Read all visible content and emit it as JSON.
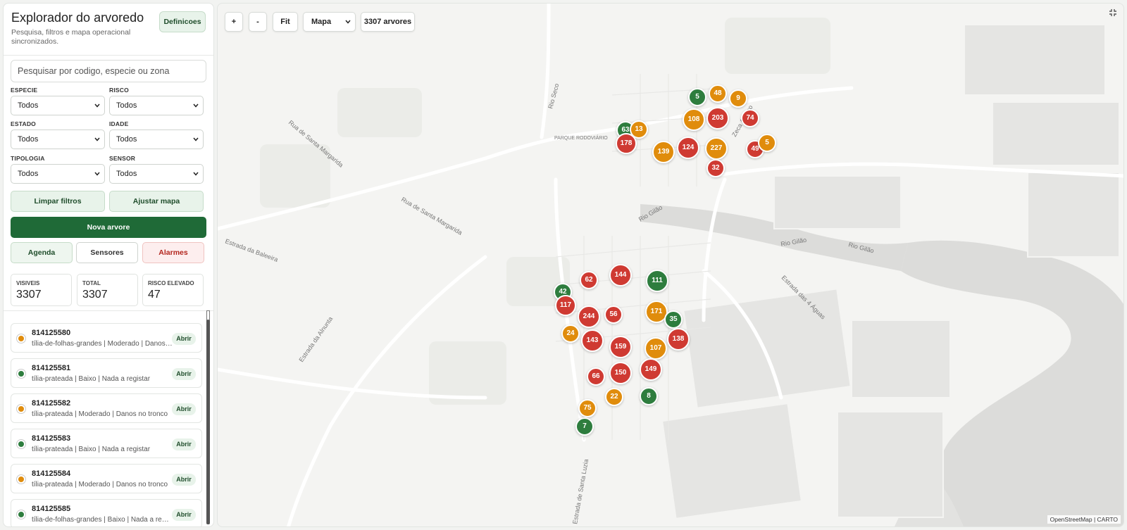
{
  "sidebar": {
    "title": "Explorador do arvoredo",
    "subtitle": "Pesquisa, filtros e mapa operacional sincronizados.",
    "settings_label": "Definicoes",
    "search_placeholder": "Pesquisar por codigo, especie ou zona",
    "filters": [
      {
        "label": "ESPECIE",
        "value": "Todos"
      },
      {
        "label": "RISCO",
        "value": "Todos"
      },
      {
        "label": "ESTADO",
        "value": "Todos"
      },
      {
        "label": "IDADE",
        "value": "Todos"
      },
      {
        "label": "TIPOLOGIA",
        "value": "Todos"
      },
      {
        "label": "SENSOR",
        "value": "Todos"
      }
    ],
    "clear_filters_label": "Limpar filtros",
    "fit_map_label": "Ajustar mapa",
    "new_tree_label": "Nova arvore",
    "agenda_label": "Agenda",
    "sensors_label": "Sensores",
    "alarms_label": "Alarmes",
    "stats": [
      {
        "label": "VISIVEIS",
        "value": "3307"
      },
      {
        "label": "TOTAL",
        "value": "3307"
      },
      {
        "label": "RISCO ELEVADO",
        "value": "47"
      }
    ],
    "items": [
      {
        "code": "814125580",
        "desc": "tília-de-folhas-grandes | Moderado | Danos no tronco",
        "status": "moderate",
        "open": "Abrir"
      },
      {
        "code": "814125581",
        "desc": "tília-prateada | Baixo | Nada a registar",
        "status": "low",
        "open": "Abrir"
      },
      {
        "code": "814125582",
        "desc": "tília-prateada | Moderado | Danos no tronco",
        "status": "moderate",
        "open": "Abrir"
      },
      {
        "code": "814125583",
        "desc": "tília-prateada | Baixo | Nada a registar",
        "status": "low",
        "open": "Abrir"
      },
      {
        "code": "814125584",
        "desc": "tília-prateada | Moderado | Danos no tronco",
        "status": "moderate",
        "open": "Abrir"
      },
      {
        "code": "814125585",
        "desc": "tília-de-folhas-grandes | Baixo | Nada a registar",
        "status": "low",
        "open": "Abrir"
      }
    ]
  },
  "map": {
    "zoom_in": "+",
    "zoom_out": "-",
    "fit": "Fit",
    "layer": "Mapa",
    "count": "3307 arvores",
    "attribution": "OpenStreetMap | CARTO",
    "labels": {
      "parque": "PARQUE RODOVIÁRIO",
      "rua_sta_margarida_1": "Rua de Santa Margarida",
      "rua_sta_margarida_2": "Rua de Santa Margarida",
      "estrada_baleeira": "Estrada da Baleeira",
      "estrada_alnunta": "Estrada da Alnunta",
      "estrada_sta_luzia": "Estrada de Santa Luzia",
      "rio_gilao_1": "Rio Gilão",
      "rio_gilao_2": "Rio Gilão",
      "rio_gilao_3": "Rio Gilão",
      "rio_seco": "Rio Seco",
      "estrada_quatro_aguas": "Estrada das 4 Águas",
      "zeca_afonso": "Zeca Afonso"
    },
    "clusters": [
      {
        "n": "5",
        "risk": "low"
      },
      {
        "n": "48",
        "risk": "moderate"
      },
      {
        "n": "9",
        "risk": "moderate"
      },
      {
        "n": "108",
        "risk": "moderate"
      },
      {
        "n": "203",
        "risk": "high"
      },
      {
        "n": "74",
        "risk": "high"
      },
      {
        "n": "63",
        "risk": "low"
      },
      {
        "n": "13",
        "risk": "moderate"
      },
      {
        "n": "178",
        "risk": "high"
      },
      {
        "n": "139",
        "risk": "moderate"
      },
      {
        "n": "124",
        "risk": "high"
      },
      {
        "n": "227",
        "risk": "moderate"
      },
      {
        "n": "49",
        "risk": "high"
      },
      {
        "n": "5",
        "risk": "moderate"
      },
      {
        "n": "32",
        "risk": "high"
      },
      {
        "n": "62",
        "risk": "high"
      },
      {
        "n": "144",
        "risk": "high"
      },
      {
        "n": "111",
        "risk": "low"
      },
      {
        "n": "42",
        "risk": "low"
      },
      {
        "n": "117",
        "risk": "high"
      },
      {
        "n": "244",
        "risk": "high"
      },
      {
        "n": "56",
        "risk": "high"
      },
      {
        "n": "171",
        "risk": "moderate"
      },
      {
        "n": "35",
        "risk": "low"
      },
      {
        "n": "24",
        "risk": "moderate"
      },
      {
        "n": "143",
        "risk": "high"
      },
      {
        "n": "159",
        "risk": "high"
      },
      {
        "n": "107",
        "risk": "moderate"
      },
      {
        "n": "138",
        "risk": "high"
      },
      {
        "n": "66",
        "risk": "high"
      },
      {
        "n": "150",
        "risk": "high"
      },
      {
        "n": "149",
        "risk": "high"
      },
      {
        "n": "22",
        "risk": "moderate"
      },
      {
        "n": "8",
        "risk": "low"
      },
      {
        "n": "75",
        "risk": "moderate"
      },
      {
        "n": "7",
        "risk": "low"
      }
    ]
  },
  "colors": {
    "low": "#2e7d3e",
    "moderate": "#e08c0c",
    "high": "#cf3a32",
    "primary": "#1f6a37",
    "alarm_text": "#b3261e"
  }
}
